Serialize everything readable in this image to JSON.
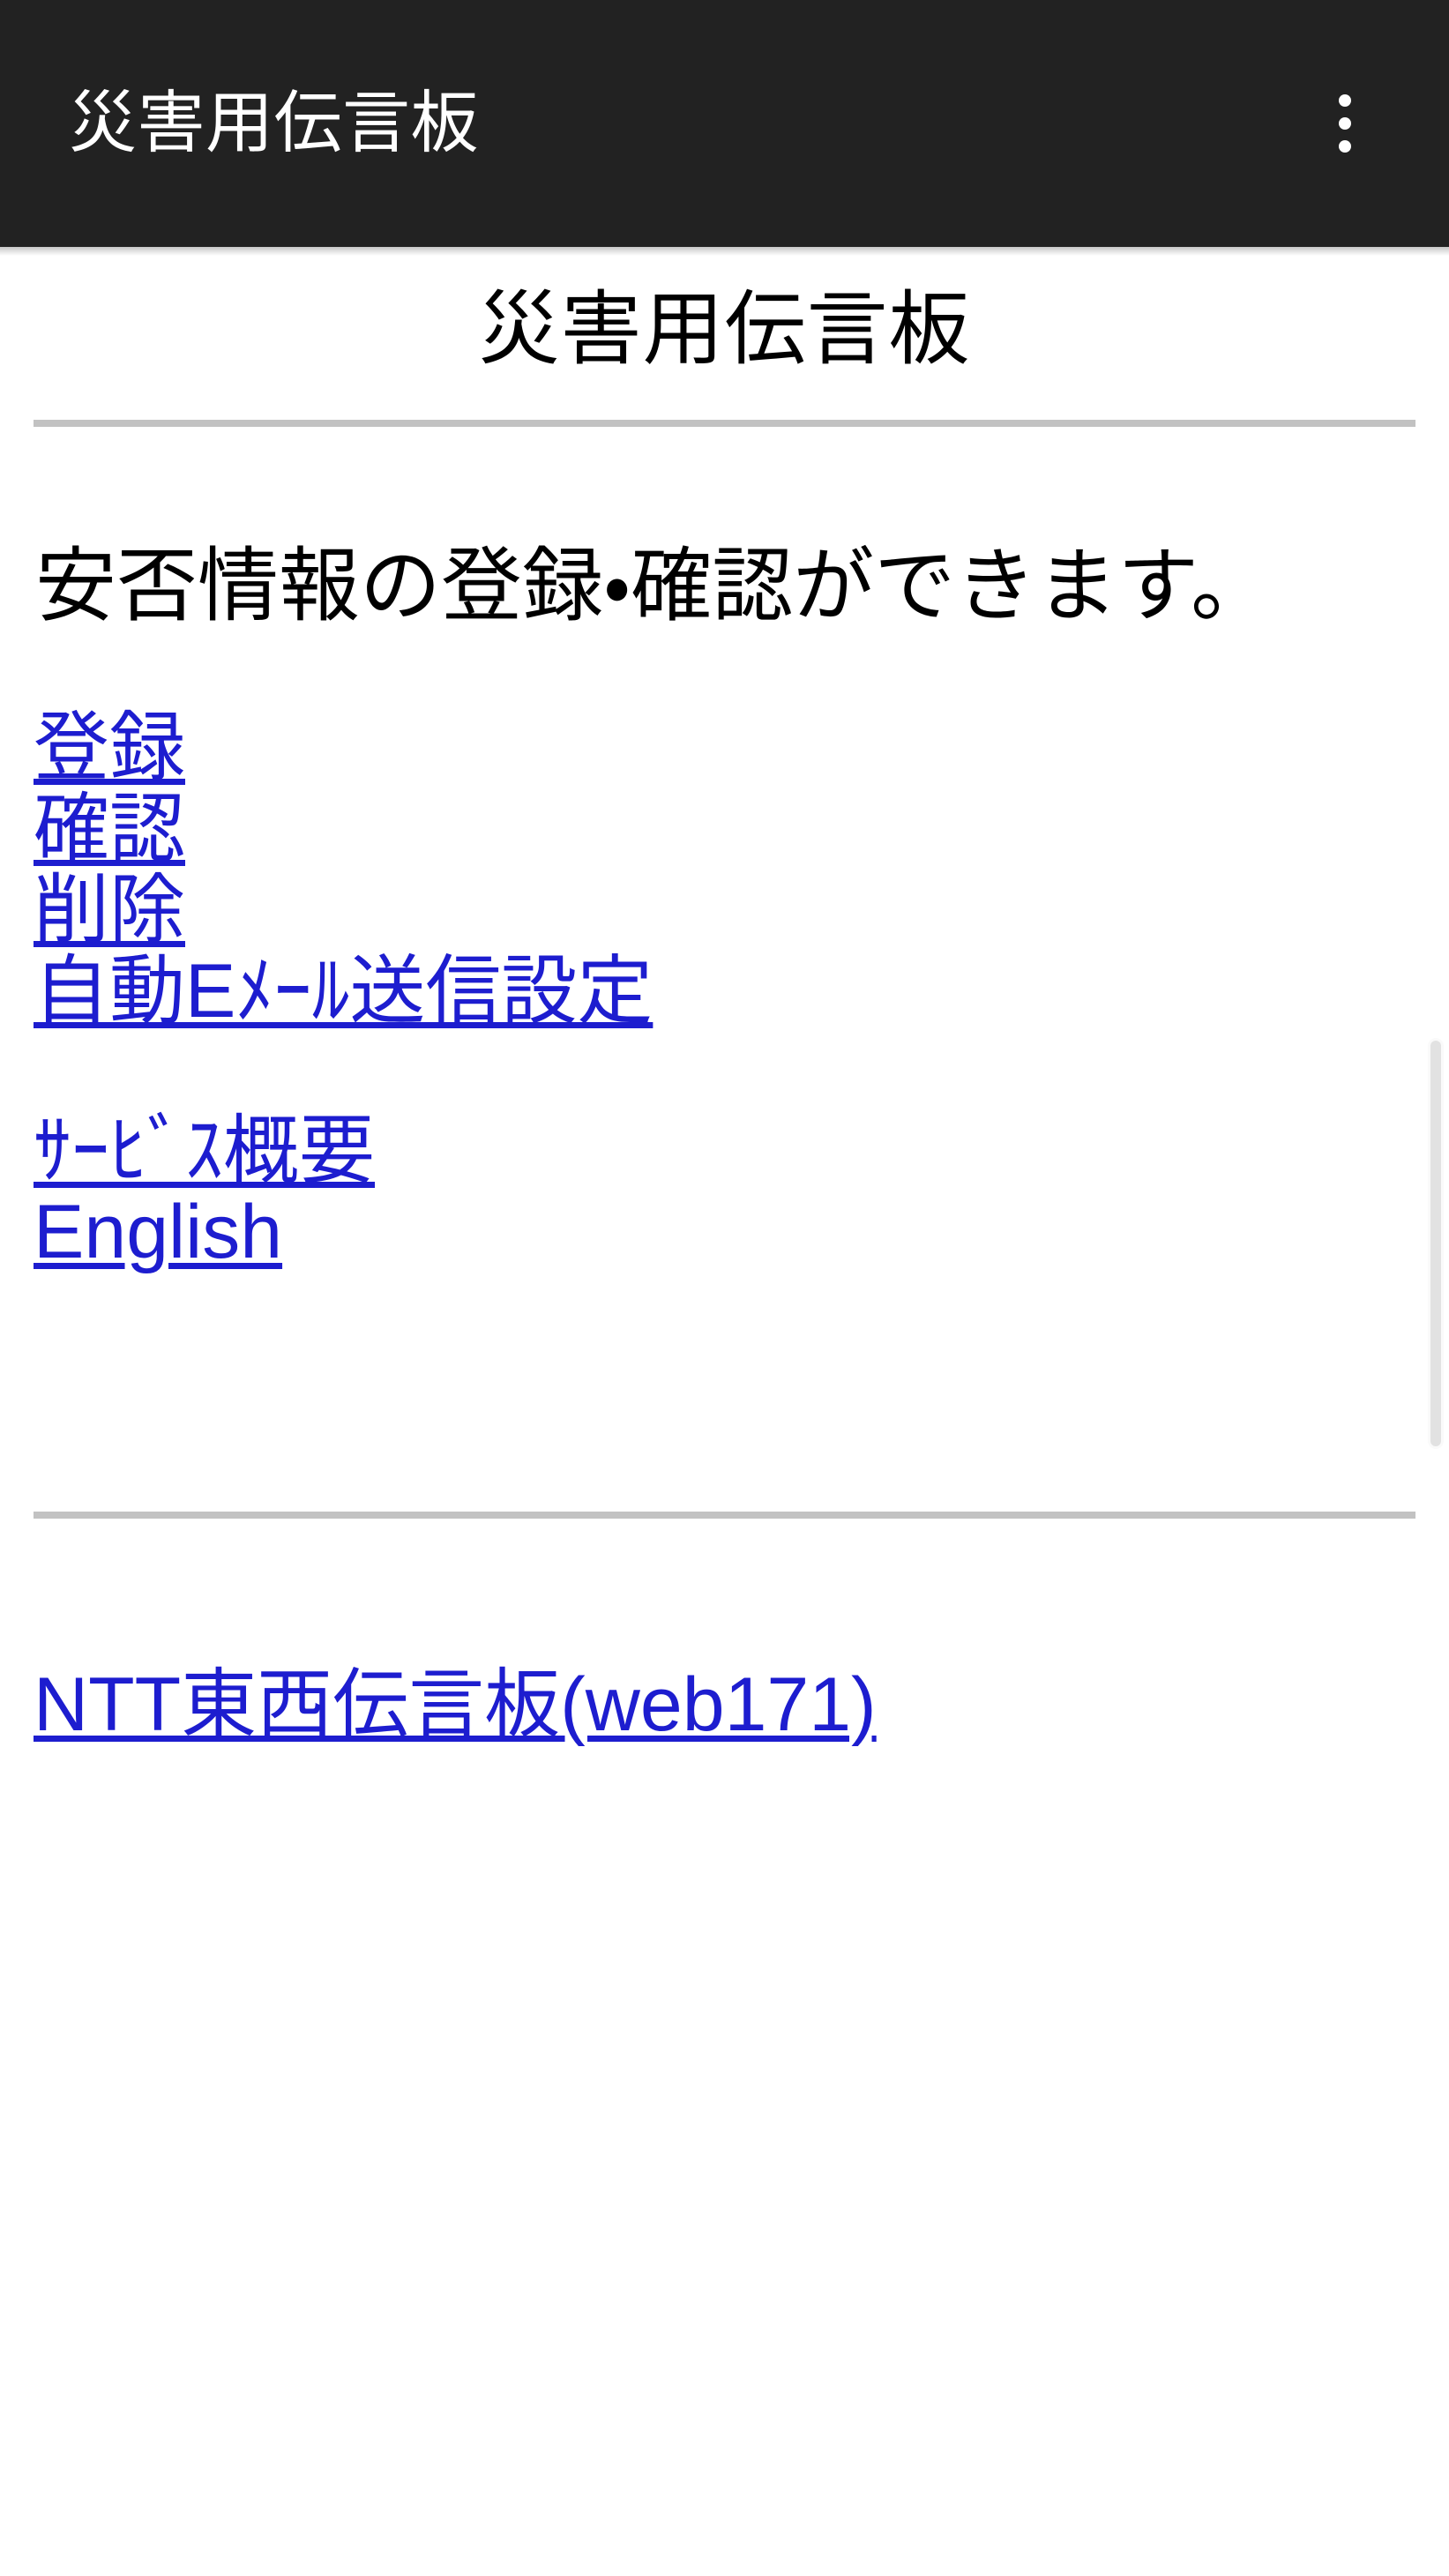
{
  "appbar": {
    "title": "災害用伝言板",
    "overflow_menu_label": "︙",
    "background_color": "#222222",
    "text_color": "#ffffff"
  },
  "page": {
    "title": "災害用伝言板",
    "body_text": "安否情報の登録・確認ができます。",
    "link_color": "#1d1dcf",
    "rule_color": "#c2c2c2",
    "background_color": "#ffffff",
    "text_color": "#000000"
  },
  "primary_links": [
    {
      "label": "登録"
    },
    {
      "label": "確認"
    },
    {
      "label": "削除"
    },
    {
      "label": "自動Eﾒｰﾙ送信設定"
    }
  ],
  "secondary_links": [
    {
      "label": "ｻｰﾋﾞｽ概要"
    },
    {
      "label": "English"
    }
  ],
  "footer_links": [
    {
      "label": "NTT東西伝言板(web171)"
    }
  ],
  "scrollbar": {
    "orientation": "vertical",
    "thumb_color": "#e2e2e2"
  }
}
